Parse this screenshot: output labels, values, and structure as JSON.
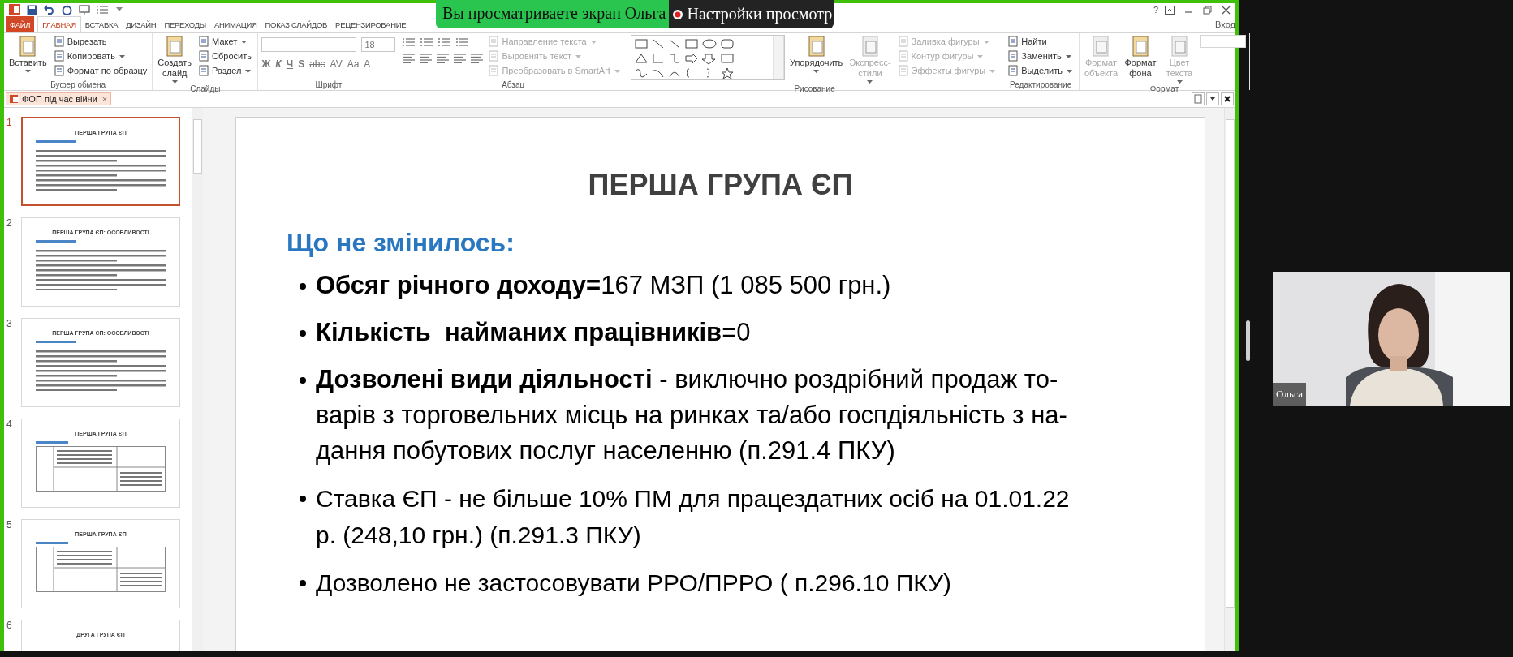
{
  "banner": {
    "text": "Вы просматриваете экран Ольга",
    "options": "Настройки просмотр"
  },
  "window": {
    "help": "?",
    "account": "Вход"
  },
  "tabs": [
    {
      "label": "ФАЙЛ",
      "kind": "file",
      "selected": false
    },
    {
      "label": "ГЛАВНАЯ",
      "kind": "tab",
      "selected": true
    },
    {
      "label": "ВСТАВКА",
      "kind": "tab",
      "selected": false
    },
    {
      "label": "ДИЗАЙН",
      "kind": "tab",
      "selected": false
    },
    {
      "label": "ПЕРЕХОДЫ",
      "kind": "tab",
      "selected": false
    },
    {
      "label": "АНИМАЦИЯ",
      "kind": "tab",
      "selected": false
    },
    {
      "label": "ПОКАЗ СЛАЙДОВ",
      "kind": "tab",
      "selected": false
    },
    {
      "label": "РЕЦЕНЗИРОВАНИЕ",
      "kind": "tab",
      "selected": false
    }
  ],
  "ribbon": {
    "groups": [
      {
        "kind": "buttons",
        "label": "Буфер обмена",
        "items": [
          {
            "lines": [
              "Вставить"
            ],
            "kind": "large",
            "disabled": false,
            "dropdown": true
          },
          {
            "label": "Вырезать",
            "kind": "compact",
            "disabled": false,
            "dropdown": false
          },
          {
            "label": "Копировать",
            "kind": "compact",
            "disabled": false,
            "dropdown": true
          },
          {
            "label": "Формат по образцу",
            "kind": "compact",
            "disabled": false,
            "dropdown": false
          }
        ]
      },
      {
        "kind": "buttons",
        "label": "Слайды",
        "items": [
          {
            "lines": [
              "Создать",
              "слайд"
            ],
            "kind": "large",
            "disabled": false,
            "dropdown": true
          },
          {
            "label": "Макет",
            "kind": "compact",
            "disabled": false,
            "dropdown": true
          },
          {
            "label": "Сбросить",
            "kind": "compact",
            "disabled": false,
            "dropdown": false
          },
          {
            "label": "Раздел",
            "kind": "compact",
            "disabled": false,
            "dropdown": true
          }
        ]
      },
      {
        "kind": "font",
        "label": "Шрифт",
        "font_size": "18",
        "styles": [
          {
            "label": "Ж",
            "kind": "bold"
          },
          {
            "label": "К",
            "kind": "italic"
          },
          {
            "label": "Ч",
            "kind": "underline"
          },
          {
            "label": "S",
            "kind": "bold"
          },
          {
            "label": "abc",
            "kind": "strike"
          },
          {
            "label": "AV",
            "kind": "plain"
          },
          {
            "label": "Aa",
            "kind": "plain"
          },
          {
            "label": "A",
            "kind": "plain"
          }
        ]
      },
      {
        "kind": "paragraph",
        "label": "Абзац",
        "items": [
          {
            "label": "Направление текста",
            "kind": "compact",
            "disabled": true,
            "dropdown": true
          },
          {
            "label": "Выровнять текст",
            "kind": "compact",
            "disabled": true,
            "dropdown": true
          },
          {
            "label": "Преобразовать в SmartArt",
            "kind": "compact",
            "disabled": true,
            "dropdown": true
          }
        ]
      },
      {
        "kind": "drawing",
        "label": "Рисование",
        "items": [
          {
            "lines": [
              "Упорядочить"
            ],
            "kind": "large",
            "disabled": false,
            "dropdown": true
          },
          {
            "lines": [
              "Экспресс-",
              "стили"
            ],
            "kind": "large",
            "disabled": true,
            "dropdown": true
          },
          {
            "label": "Заливка фигуры",
            "kind": "compact",
            "disabled": true,
            "dropdown": true
          },
          {
            "label": "Контур фигуры",
            "kind": "compact",
            "disabled": true,
            "dropdown": true
          },
          {
            "label": "Эффекты фигуры",
            "kind": "compact",
            "disabled": true,
            "dropdown": true
          }
        ]
      },
      {
        "kind": "buttons",
        "label": "Редактирование",
        "items": [
          {
            "label": "Найти",
            "kind": "compact",
            "disabled": false,
            "dropdown": false
          },
          {
            "label": "Заменить",
            "kind": "compact",
            "disabled": false,
            "dropdown": true
          },
          {
            "label": "Выделить",
            "kind": "compact",
            "disabled": false,
            "dropdown": true
          }
        ]
      },
      {
        "kind": "buttons",
        "label": "Формат",
        "items": [
          {
            "lines": [
              "Формат",
              "объекта"
            ],
            "kind": "large",
            "disabled": true,
            "dropdown": false
          },
          {
            "lines": [
              "Формат",
              "фона"
            ],
            "kind": "large",
            "disabled": false,
            "dropdown": false
          },
          {
            "lines": [
              "Цвет",
              "текста"
            ],
            "kind": "large",
            "disabled": true,
            "dropdown": true
          }
        ]
      }
    ]
  },
  "document_tab": {
    "title": "ФОП під час війни",
    "close": "×"
  },
  "thumbnails": [
    {
      "number": "1",
      "title": "ПЕРША ГРУПА ЄП",
      "kind": "text",
      "selected": true
    },
    {
      "number": "2",
      "title": "ПЕРША ГРУПА ЄП: ОСОБЛИВОСТІ",
      "kind": "text",
      "selected": false
    },
    {
      "number": "3",
      "title": "ПЕРША ГРУПА ЄП: ОСОБЛИВОСТІ",
      "kind": "text",
      "selected": false
    },
    {
      "number": "4",
      "title": "ПЕРША ГРУПА ЄП",
      "kind": "table",
      "selected": false
    },
    {
      "number": "5",
      "title": "ПЕРША ГРУПА ЄП",
      "kind": "table",
      "selected": false
    },
    {
      "number": "6",
      "title": "ДРУГА ГРУПА ЄП",
      "kind": "title",
      "selected": false
    }
  ],
  "slide": {
    "title": "ПЕРША ГРУПА ЄП",
    "subheading": "Що не змінилось:",
    "bullets": [
      {
        "kind": "major",
        "lines": [
          "**Обсяг річного доходу=**167 МЗП (1 085 500 грн.)"
        ]
      },
      {
        "kind": "major",
        "lines": [
          "**Кількість  найманих працівників**=0"
        ]
      },
      {
        "kind": "major",
        "lines": [
          "**Дозволені види діяльності** - виключно роздрібний продаж то-",
          "варів з торговельних місць на ринках та/або госпдіяльність з на-",
          "дання побутових послуг населенню (п.291.4 ПКУ)"
        ]
      },
      {
        "kind": "minor",
        "lines": [
          "Ставка ЄП - не більше 10% ПМ для працездатних осіб на 01.01.22",
          "р. (248,10 грн.) (п.291.3 ПКУ)"
        ]
      },
      {
        "kind": "minor",
        "lines": [
          "Дозволено не застосовувати РРО/ПРРО ( п.296.10 ПКУ)"
        ]
      }
    ]
  },
  "video": {
    "name": "Ольга"
  }
}
